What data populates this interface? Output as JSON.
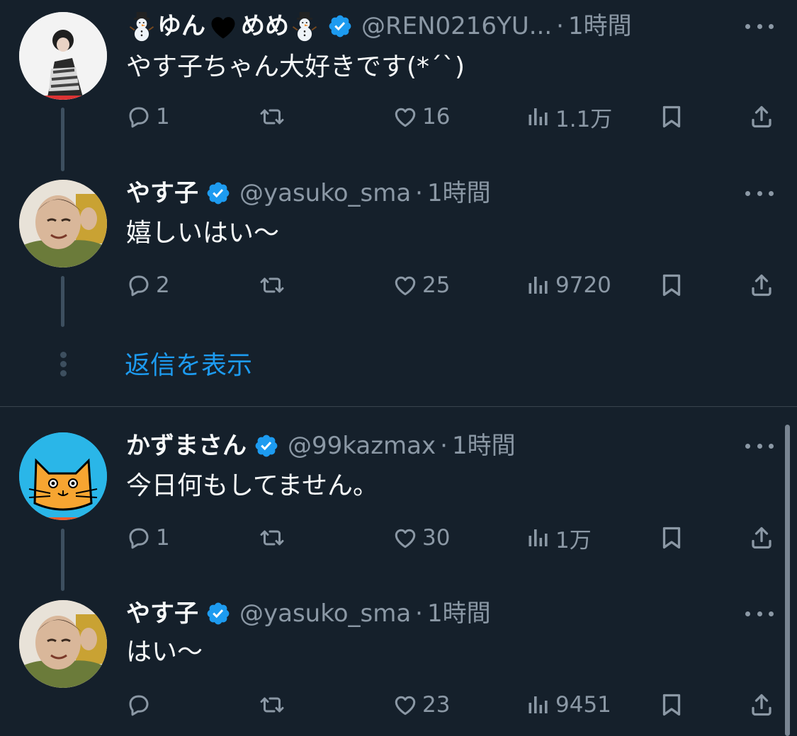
{
  "tweets": [
    {
      "name_part1": "ゆん",
      "name_part2": "めめ",
      "handle": "@REN0216YU...",
      "separator": "·",
      "time": "1時間",
      "text": "やす子ちゃん大好きです(*´`)",
      "replies": "1",
      "retweets": "",
      "likes": "16",
      "views": "1.1万"
    },
    {
      "name": "やす子",
      "handle": "@yasuko_sma",
      "separator": "·",
      "time": "1時間",
      "text": "嬉しいはい〜",
      "replies": "2",
      "retweets": "",
      "likes": "25",
      "views": "9720"
    },
    {
      "name": "かずまさん",
      "handle": "@99kazmax",
      "separator": "·",
      "time": "1時間",
      "text": "今日何もしてません。",
      "replies": "1",
      "retweets": "",
      "likes": "30",
      "views": "1万"
    },
    {
      "name": "やす子",
      "handle": "@yasuko_sma",
      "separator": "·",
      "time": "1時間",
      "text": "はい〜",
      "replies": "",
      "retweets": "",
      "likes": "23",
      "views": "9451"
    }
  ],
  "show_replies_label": "返信を表示",
  "icons": {
    "reply": "reply-icon",
    "retweet": "retweet-icon",
    "like": "heart-icon",
    "views": "views-icon",
    "bookmark": "bookmark-icon",
    "share": "share-icon",
    "verified": "verified-badge-icon",
    "more": "more-options-icon"
  },
  "colors": {
    "background": "#15202b",
    "text": "#f7f9f9",
    "muted": "#8b98a5",
    "accent": "#1d9bf0"
  }
}
